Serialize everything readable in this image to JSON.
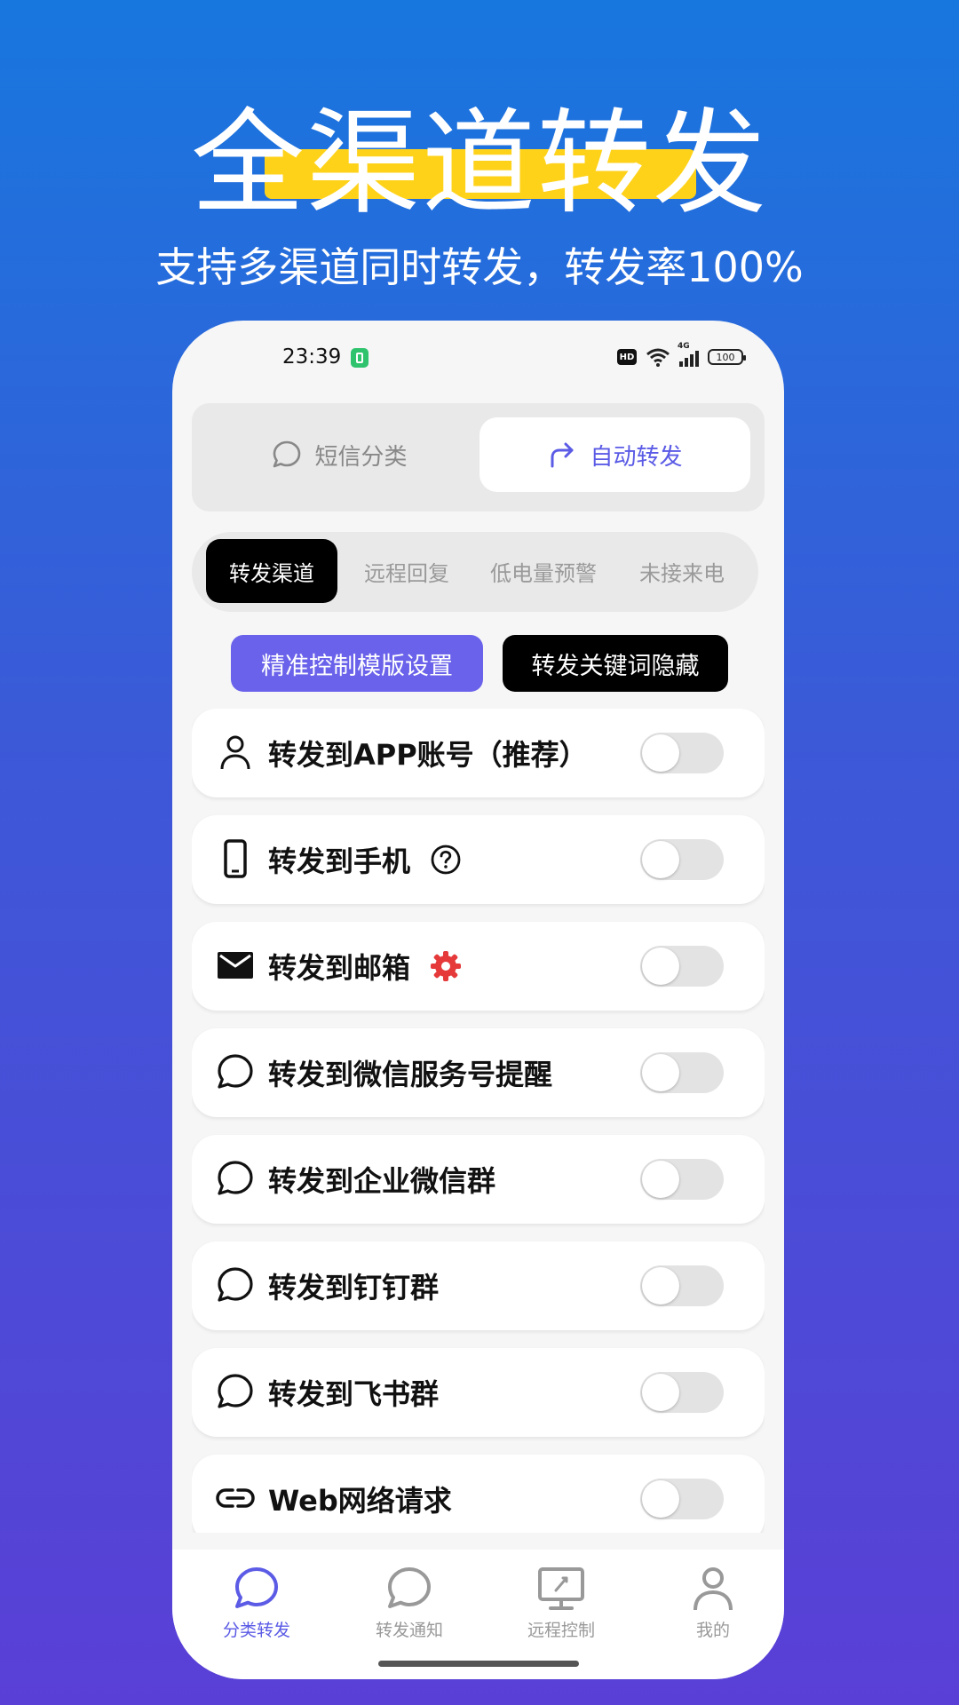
{
  "hero": {
    "title": "全渠道转发",
    "subtitle": "支持多渠道同时转发，转发率100%"
  },
  "status_bar": {
    "time": "23:39",
    "hd": "HD",
    "network": "4G",
    "battery": "100"
  },
  "segment": {
    "inactive_label": "短信分类",
    "active_label": "自动转发"
  },
  "tabs": [
    {
      "label": "转发渠道",
      "active": true
    },
    {
      "label": "远程回复",
      "active": false
    },
    {
      "label": "低电量预警",
      "active": false
    },
    {
      "label": "未接来电",
      "active": false
    }
  ],
  "buttons": {
    "template": "精准控制模版设置",
    "keyword": "转发关键词隐藏"
  },
  "channels": [
    {
      "label": "转发到APP账号（推荐）",
      "icon": "person-icon",
      "enabled": false
    },
    {
      "label": "转发到手机",
      "icon": "phone-icon",
      "extra": "help-icon",
      "enabled": false
    },
    {
      "label": "转发到邮箱",
      "icon": "mail-icon",
      "extra": "gear-icon",
      "enabled": false
    },
    {
      "label": "转发到微信服务号提醒",
      "icon": "chat-bubble-icon",
      "enabled": false
    },
    {
      "label": "转发到企业微信群",
      "icon": "chat-bubble-icon",
      "enabled": false
    },
    {
      "label": "转发到钉钉群",
      "icon": "chat-bubble-icon",
      "enabled": false
    },
    {
      "label": "转发到飞书群",
      "icon": "chat-bubble-icon",
      "enabled": false
    },
    {
      "label": "Web网络请求",
      "icon": "link-icon",
      "enabled": false
    }
  ],
  "nav": [
    {
      "label": "分类转发",
      "icon": "chat-bubble-icon",
      "active": true
    },
    {
      "label": "转发通知",
      "icon": "chat-bubble-icon",
      "active": false
    },
    {
      "label": "远程控制",
      "icon": "monitor-icon",
      "active": false
    },
    {
      "label": "我的",
      "icon": "person-icon",
      "active": false
    }
  ],
  "colors": {
    "accent": "#5b5be6",
    "highlight": "#ffd21a",
    "gear": "#e5393a"
  }
}
